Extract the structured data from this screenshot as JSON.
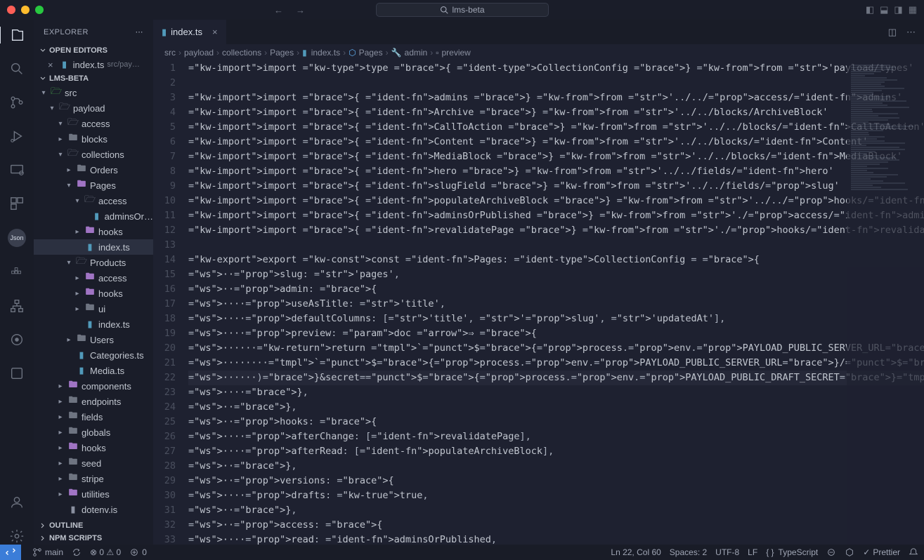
{
  "titlebar": {
    "search": "lms-beta"
  },
  "sidebar": {
    "title": "EXPLORER",
    "sections": {
      "openEditors": "OPEN EDITORS",
      "project": "LMS-BETA",
      "outline": "OUTLINE",
      "npm": "NPM SCRIPTS"
    },
    "openEditorItem": {
      "name": "index.ts",
      "detail": "src/pay…"
    },
    "tree": [
      {
        "label": "src",
        "indent": 0,
        "chev": "▾",
        "icon": "folder-src"
      },
      {
        "label": "payload",
        "indent": 1,
        "chev": "▾",
        "icon": "folder-open"
      },
      {
        "label": "access",
        "indent": 2,
        "chev": "▾",
        "icon": "folder-open"
      },
      {
        "label": "blocks",
        "indent": 2,
        "chev": "▸",
        "icon": "folder"
      },
      {
        "label": "collections",
        "indent": 2,
        "chev": "▾",
        "icon": "folder-open"
      },
      {
        "label": "Orders",
        "indent": 3,
        "chev": "▸",
        "icon": "folder"
      },
      {
        "label": "Pages",
        "indent": 3,
        "chev": "▾",
        "icon": "folder-purple"
      },
      {
        "label": "access",
        "indent": 4,
        "chev": "▾",
        "icon": "folder-open"
      },
      {
        "label": "adminsOr…",
        "indent": 5,
        "chev": "",
        "icon": "file-ts"
      },
      {
        "label": "hooks",
        "indent": 4,
        "chev": "▸",
        "icon": "folder-purple"
      },
      {
        "label": "index.ts",
        "indent": 4,
        "chev": "",
        "icon": "file-ts",
        "active": true
      },
      {
        "label": "Products",
        "indent": 3,
        "chev": "▾",
        "icon": "folder-open"
      },
      {
        "label": "access",
        "indent": 4,
        "chev": "▸",
        "icon": "folder-purple"
      },
      {
        "label": "hooks",
        "indent": 4,
        "chev": "▸",
        "icon": "folder-purple"
      },
      {
        "label": "ui",
        "indent": 4,
        "chev": "▸",
        "icon": "folder"
      },
      {
        "label": "index.ts",
        "indent": 4,
        "chev": "",
        "icon": "file-ts"
      },
      {
        "label": "Users",
        "indent": 3,
        "chev": "▸",
        "icon": "folder"
      },
      {
        "label": "Categories.ts",
        "indent": 3,
        "chev": "",
        "icon": "file-ts"
      },
      {
        "label": "Media.ts",
        "indent": 3,
        "chev": "",
        "icon": "file-ts"
      },
      {
        "label": "components",
        "indent": 2,
        "chev": "▸",
        "icon": "folder-purple"
      },
      {
        "label": "endpoints",
        "indent": 2,
        "chev": "▸",
        "icon": "folder"
      },
      {
        "label": "fields",
        "indent": 2,
        "chev": "▸",
        "icon": "folder"
      },
      {
        "label": "globals",
        "indent": 2,
        "chev": "▸",
        "icon": "folder"
      },
      {
        "label": "hooks",
        "indent": 2,
        "chev": "▸",
        "icon": "folder-purple"
      },
      {
        "label": "seed",
        "indent": 2,
        "chev": "▸",
        "icon": "folder"
      },
      {
        "label": "stripe",
        "indent": 2,
        "chev": "▸",
        "icon": "folder"
      },
      {
        "label": "utilities",
        "indent": 2,
        "chev": "▸",
        "icon": "folder-purple"
      },
      {
        "label": "dotenv.is",
        "indent": 2,
        "chev": "",
        "icon": "file-icon"
      }
    ]
  },
  "tab": {
    "name": "index.ts"
  },
  "breadcrumb": [
    "src",
    "payload",
    "collections",
    "Pages",
    "index.ts",
    "Pages",
    "admin",
    "preview"
  ],
  "code": {
    "lines": [
      {
        "n": 1,
        "t": "import type { CollectionConfig } from 'payload/types'"
      },
      {
        "n": 2,
        "t": ""
      },
      {
        "n": 3,
        "t": "import { admins } from '../../access/admins'"
      },
      {
        "n": 4,
        "t": "import { Archive } from '../../blocks/ArchiveBlock'"
      },
      {
        "n": 5,
        "t": "import { CallToAction } from '../../blocks/CallToAction'"
      },
      {
        "n": 6,
        "t": "import { Content } from '../../blocks/Content'"
      },
      {
        "n": 7,
        "t": "import { MediaBlock } from '../../blocks/MediaBlock'"
      },
      {
        "n": 8,
        "t": "import { hero } from '../../fields/hero'"
      },
      {
        "n": 9,
        "t": "import { slugField } from '../../fields/slug'"
      },
      {
        "n": 10,
        "t": "import { populateArchiveBlock } from '../../hooks/populateArchiveBlock'"
      },
      {
        "n": 11,
        "t": "import { adminsOrPublished } from './access/adminsOrPublished'"
      },
      {
        "n": 12,
        "t": "import { revalidatePage } from './hooks/revalidatePage'"
      },
      {
        "n": 13,
        "t": ""
      },
      {
        "n": 14,
        "t": "export const Pages: CollectionConfig = {"
      },
      {
        "n": 15,
        "t": "  slug: 'pages',"
      },
      {
        "n": 16,
        "t": "  admin: {"
      },
      {
        "n": 17,
        "t": "    useAsTitle: 'title',"
      },
      {
        "n": 18,
        "t": "    defaultColumns: ['title', 'slug', 'updatedAt'],"
      },
      {
        "n": 19,
        "t": "    preview: doc => {"
      },
      {
        "n": 20,
        "t": "      return `${process.env.PAYLOAD_PUBLIC_SERVER_URL}/api/preview?url=${encodeURIComponent("
      },
      {
        "n": 21,
        "t": "        `${process.env.PAYLOAD_PUBLIC_SERVER_URL}/${doc.slug !== 'home' ? doc.slug : ''}`,"
      },
      {
        "n": 22,
        "t": "      )}&secret=${process.env.PAYLOAD_PUBLIC_DRAFT_SECRET}`",
        "hl": true,
        "cursor": true
      },
      {
        "n": 23,
        "t": "    },"
      },
      {
        "n": 24,
        "t": "  },"
      },
      {
        "n": 25,
        "t": "  hooks: {"
      },
      {
        "n": 26,
        "t": "    afterChange: [revalidatePage],"
      },
      {
        "n": 27,
        "t": "    afterRead: [populateArchiveBlock],"
      },
      {
        "n": 28,
        "t": "  },"
      },
      {
        "n": 29,
        "t": "  versions: {"
      },
      {
        "n": 30,
        "t": "    drafts: true,"
      },
      {
        "n": 31,
        "t": "  },"
      },
      {
        "n": 32,
        "t": "  access: {"
      },
      {
        "n": 33,
        "t": "    read: adminsOrPublished,"
      }
    ]
  },
  "statusbar": {
    "branch": "main",
    "sync": "0↓ 0↑",
    "problems": "⊗ 0  ⚠ 0",
    "cursor": "Ln 22, Col 60",
    "spaces": "Spaces: 2",
    "encoding": "UTF-8",
    "eol": "LF",
    "lang": "TypeScript",
    "prettier": "Prettier"
  }
}
